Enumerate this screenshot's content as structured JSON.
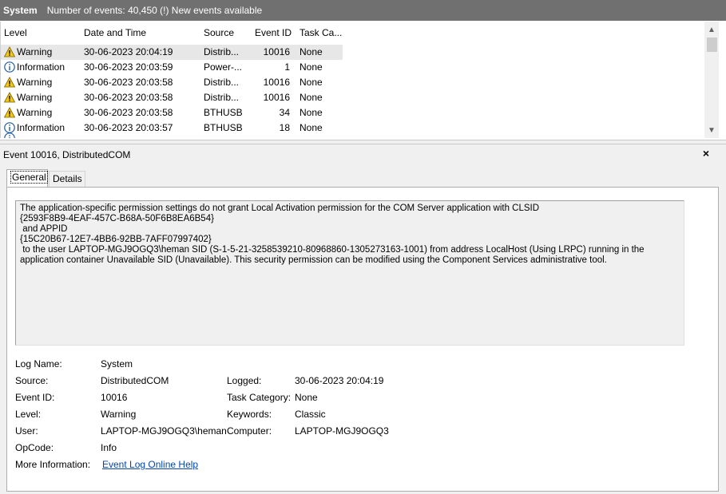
{
  "header": {
    "log_name": "System",
    "events_text": "Number of events: 40,450 (!) New events available"
  },
  "columns": [
    "Level",
    "Date and Time",
    "Source",
    "Event ID",
    "Task Ca..."
  ],
  "events": [
    {
      "level": "Warning",
      "icon": "warning-icon",
      "date": "30-06-2023 20:04:19",
      "source": "Distrib...",
      "id": "10016",
      "task": "None"
    },
    {
      "level": "Information",
      "icon": "information-icon",
      "date": "30-06-2023 20:03:59",
      "source": "Power-...",
      "id": "1",
      "task": "None"
    },
    {
      "level": "Warning",
      "icon": "warning-icon",
      "date": "30-06-2023 20:03:58",
      "source": "Distrib...",
      "id": "10016",
      "task": "None"
    },
    {
      "level": "Warning",
      "icon": "warning-icon",
      "date": "30-06-2023 20:03:58",
      "source": "Distrib...",
      "id": "10016",
      "task": "None"
    },
    {
      "level": "Warning",
      "icon": "warning-icon",
      "date": "30-06-2023 20:03:58",
      "source": "BTHUSB",
      "id": "34",
      "task": "None"
    },
    {
      "level": "Information",
      "icon": "information-icon",
      "date": "30-06-2023 20:03:57",
      "source": "BTHUSB",
      "id": "18",
      "task": "None"
    }
  ],
  "detail": {
    "title": "Event 10016, DistributedCOM",
    "close_glyph": "×",
    "tabs": [
      "General",
      "Details"
    ],
    "description_lines": [
      "The application-specific permission settings do not grant Local Activation permission for the COM Server application with CLSID",
      "{2593F8B9-4EAF-457C-B68A-50F6B8EA6B54}",
      " and APPID",
      "{15C20B67-12E7-4BB6-92BB-7AFF07997402}",
      " to the user LAPTOP-MGJ9OGQ3\\heman SID (S-1-5-21-3258539210-80968860-1305273163-1001) from address LocalHost (Using LRPC) running in the",
      "application container Unavailable SID (Unavailable). This security permission can be modified using the Component Services administrative tool."
    ],
    "props": {
      "log_name_label": "Log Name:",
      "log_name": "System",
      "source_label": "Source:",
      "source": "DistributedCOM",
      "logged_label": "Logged:",
      "logged": "30-06-2023 20:04:19",
      "event_id_label": "Event ID:",
      "event_id": "10016",
      "task_category_label": "Task Category:",
      "task_category": "None",
      "level_label": "Level:",
      "level": "Warning",
      "keywords_label": "Keywords:",
      "keywords": "Classic",
      "user_label": "User:",
      "user": "LAPTOP-MGJ9OGQ3\\heman",
      "computer_label": "Computer:",
      "computer": "LAPTOP-MGJ9OGQ3",
      "opcode_label": "OpCode:",
      "opcode": "Info",
      "more_info_label": "More Information:",
      "more_info_link": "Event Log Online Help"
    }
  },
  "colors": {
    "titlebar": "#707070",
    "selection": "#e7e7e7",
    "warning": "#f2c811",
    "information": "#1c5aa8",
    "link": "#0645ad"
  }
}
